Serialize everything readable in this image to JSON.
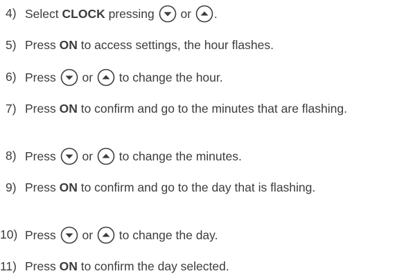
{
  "steps": [
    {
      "number": "4)",
      "parts": {
        "a": "Select ",
        "b_bold": "CLOCK",
        "c": " pressing ",
        "d": " or ",
        "e": "."
      },
      "down_icon": "arrow-down-button-icon",
      "up_icon": "arrow-up-button-icon"
    },
    {
      "number": "5)",
      "parts": {
        "a": "Press ",
        "b_bold": "ON",
        "c": " to access settings, the hour flashes."
      }
    },
    {
      "number": "6)",
      "parts": {
        "a": "Press ",
        "d": " or ",
        "e": " to change the hour."
      },
      "down_icon": "arrow-down-button-icon",
      "up_icon": "arrow-up-button-icon"
    },
    {
      "number": "7)",
      "parts": {
        "a": "Press ",
        "b_bold": "ON",
        "c": " to confirm and go to the minutes that are flashing."
      }
    },
    {
      "number": "8)",
      "parts": {
        "a": "Press ",
        "d": " or ",
        "e": " to change the minutes."
      },
      "down_icon": "arrow-down-button-icon",
      "up_icon": "arrow-up-button-icon"
    },
    {
      "number": "9)",
      "parts": {
        "a": "Press ",
        "b_bold": "ON",
        "c": " to confirm and go to the day that is flashing."
      }
    },
    {
      "number": "10)",
      "parts": {
        "a": "Press ",
        "d": " or ",
        "e": " to change the day."
      },
      "down_icon": "arrow-down-button-icon",
      "up_icon": "arrow-up-button-icon"
    },
    {
      "number": "11)",
      "parts": {
        "a": "Press ",
        "b_bold": "ON",
        "c": " to confirm the day selected."
      }
    }
  ],
  "colors": {
    "text": "#3c3c3c",
    "icon_stroke": "#3c3c3c",
    "icon_fill": "#ffffff"
  }
}
